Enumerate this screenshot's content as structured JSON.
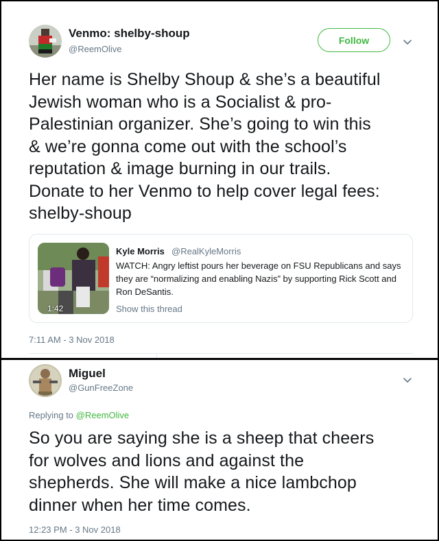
{
  "tweet": {
    "author_name": "Venmo: shelby-shoup",
    "author_handle": "@ReemOlive",
    "follow_label": "Follow",
    "text_lines": [
      "Her name is Shelby Shoup & she’s a beautiful",
      "Jewish woman who is a Socialist & pro-",
      "Palestinian organizer. She’s going to win this",
      "& we’re gonna come out with the school’s",
      "reputation & image burning in our trails.",
      "Donate to her Venmo to help cover legal fees:",
      "shelby-shoup"
    ],
    "timestamp": "7:11 AM - 3 Nov 2018",
    "quote": {
      "author_name": "Kyle Morris",
      "author_handle": "@RealKyleMorris",
      "text": "WATCH: Angry leftist pours her beverage on FSU Republicans and says they are “normalizing and enabling Nazis” by supporting Rick Scott and Ron DeSantis.",
      "media_duration": "1:42",
      "show_thread": "Show this thread"
    }
  },
  "reply": {
    "author_name": "Miguel",
    "author_handle": "@GunFreeZone",
    "replying_prefix": "Replying to",
    "replying_to": "@ReemOlive",
    "text_lines": [
      "So you are saying she is a sheep that cheers",
      "for wolves and lions and against the",
      "shepherds. She will make a nice lambchop",
      "dinner when her time comes."
    ],
    "timestamp": "12:23 PM - 3 Nov 2018"
  },
  "colors": {
    "accent_green": "#3fb73f",
    "secondary_text": "#657786",
    "primary_text": "#14171a",
    "border": "#e1e8ed"
  },
  "icons": {
    "caret": "chevron-down-icon",
    "media": "video-thumbnail"
  }
}
